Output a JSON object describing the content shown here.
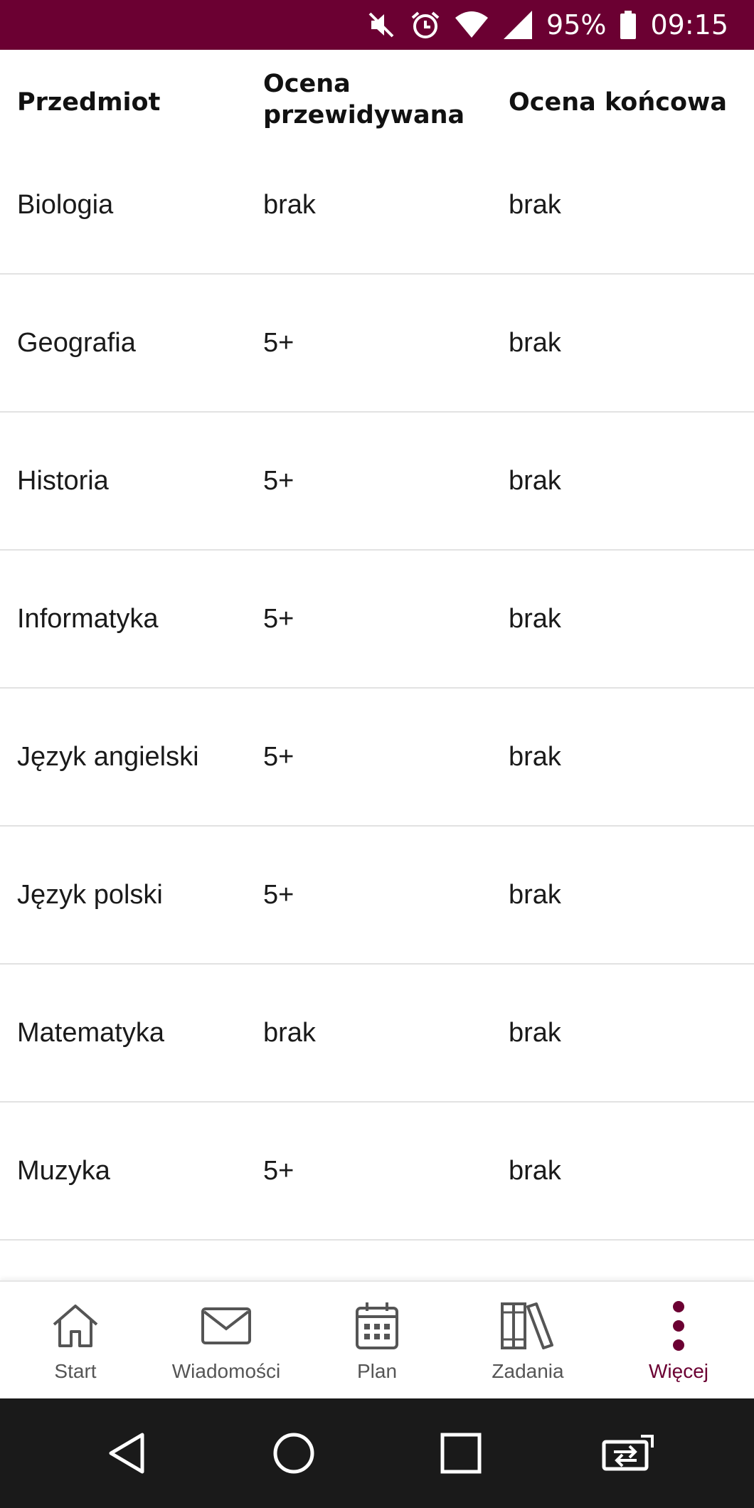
{
  "status_bar": {
    "battery": "95%",
    "time": "09:15",
    "icons": [
      "mute-icon",
      "alarm-icon",
      "wifi-icon",
      "signal-icon",
      "battery-icon"
    ],
    "background": "#6b0032"
  },
  "table": {
    "headers": {
      "subject": "Przedmiot",
      "predicted_line1": "Ocena",
      "predicted_line2": "przewidywana",
      "final": "Ocena końcowa"
    },
    "rows": [
      {
        "subject": "Biologia",
        "predicted": "brak",
        "final": "brak"
      },
      {
        "subject": "Geografia",
        "predicted": "5+",
        "final": "brak"
      },
      {
        "subject": "Historia",
        "predicted": "5+",
        "final": "brak"
      },
      {
        "subject": "Informatyka",
        "predicted": "5+",
        "final": "brak"
      },
      {
        "subject": "Język angielski",
        "predicted": "5+",
        "final": "brak"
      },
      {
        "subject": "Język polski",
        "predicted": "5+",
        "final": "brak"
      },
      {
        "subject": "Matematyka",
        "predicted": "brak",
        "final": "brak"
      },
      {
        "subject": "Muzyka",
        "predicted": "5+",
        "final": "brak"
      }
    ]
  },
  "bottom_nav": {
    "items": [
      {
        "label": "Start",
        "icon": "home-icon",
        "active": false
      },
      {
        "label": "Wiadomości",
        "icon": "envelope-icon",
        "active": false
      },
      {
        "label": "Plan",
        "icon": "calendar-icon",
        "active": false
      },
      {
        "label": "Zadania",
        "icon": "books-icon",
        "active": false
      },
      {
        "label": "Więcej",
        "icon": "more-vertical-icon",
        "active": true
      }
    ],
    "accent": "#6b0032"
  },
  "system_nav": {
    "icons": [
      "back-icon",
      "home-circle-icon",
      "recents-icon",
      "screen-rotate-icon"
    ]
  }
}
